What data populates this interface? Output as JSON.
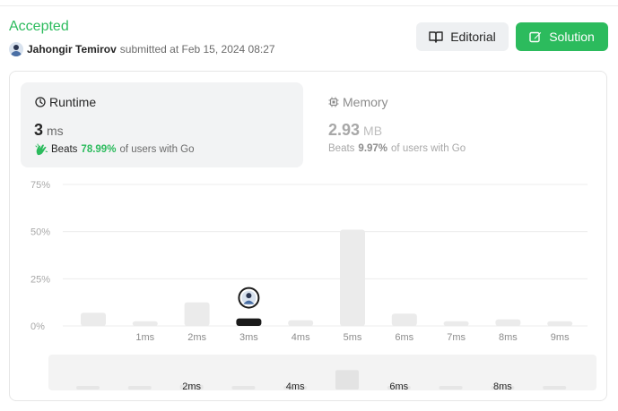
{
  "header": {
    "status": "Accepted",
    "submitter_name": "Jahongir Temirov",
    "submitted_text": "submitted at Feb 15, 2024 08:27"
  },
  "buttons": {
    "editorial": "Editorial",
    "solution": "Solution"
  },
  "runtime": {
    "title": "Runtime",
    "value": "3",
    "unit": "ms",
    "beats_label": "Beats",
    "beats_pct": "78.99%",
    "beats_suffix": "of users with Go"
  },
  "memory": {
    "title": "Memory",
    "value": "2.93",
    "unit": "MB",
    "beats_label": "Beats",
    "beats_pct": "9.97%",
    "beats_suffix": "of users with Go"
  },
  "colors": {
    "accent_green": "#2cbb5d",
    "bar_default": "#ebebeb",
    "bar_selected": "#1a1a1a"
  },
  "chart_data": {
    "type": "bar",
    "categories": [
      "",
      "1ms",
      "2ms",
      "3ms",
      "4ms",
      "5ms",
      "6ms",
      "7ms",
      "8ms",
      "9ms"
    ],
    "values": [
      7,
      2.5,
      12.5,
      4,
      3,
      51,
      6.5,
      2.5,
      3.5,
      2.5
    ],
    "highlight_index": 3,
    "ylim": [
      0,
      75
    ],
    "y_ticks": [
      "75%",
      "50%",
      "25%",
      "0%"
    ],
    "grid": true,
    "minimap": {
      "values": [
        7,
        2.5,
        12.5,
        4,
        3,
        51,
        6.5,
        2.5,
        3.5,
        2.5
      ],
      "tick_labels": [
        "2ms",
        "4ms",
        "6ms",
        "8ms"
      ]
    }
  }
}
